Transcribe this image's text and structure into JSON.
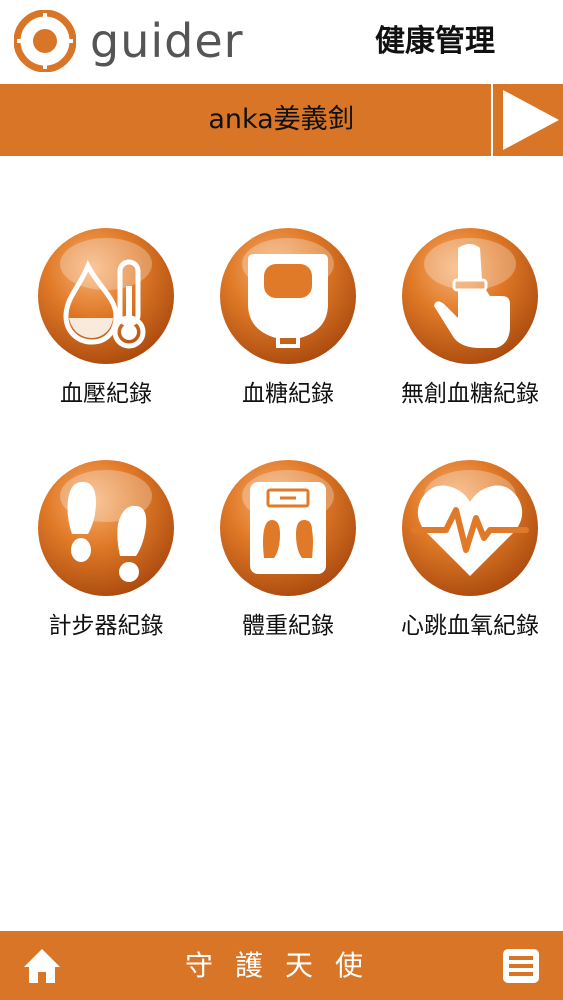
{
  "header": {
    "brand": "guider",
    "title": "健康管理"
  },
  "user_bar": {
    "user_name": "anka姜義釗",
    "next_icon": "play-arrow-icon"
  },
  "tiles": [
    {
      "label": "血壓紀錄",
      "icon": "drop-thermometer-icon"
    },
    {
      "label": "血糖紀錄",
      "icon": "glucose-meter-icon"
    },
    {
      "label": "無創血糖紀錄",
      "icon": "finger-sensor-icon"
    },
    {
      "label": "計步器紀錄",
      "icon": "footprints-icon"
    },
    {
      "label": "體重紀錄",
      "icon": "scale-icon"
    },
    {
      "label": "心跳血氧紀錄",
      "icon": "heartbeat-icon"
    }
  ],
  "bottom_bar": {
    "title": "守護天使",
    "home_icon": "home-icon",
    "menu_icon": "menu-icon"
  },
  "colors": {
    "accent": "#d97527",
    "orb": "#d9701f",
    "text": "#111111"
  }
}
